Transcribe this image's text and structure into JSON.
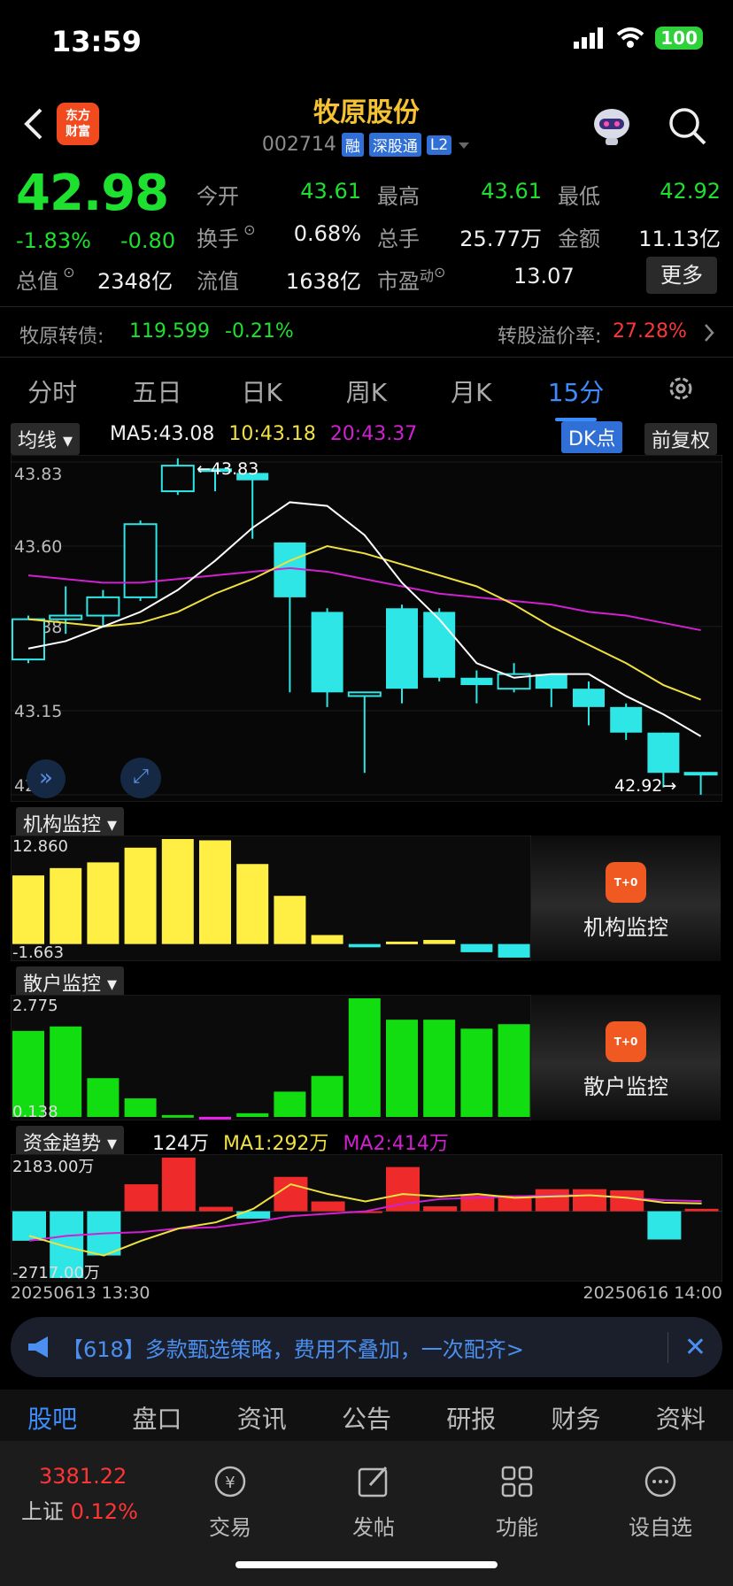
{
  "status": {
    "time": "13:59",
    "battery": "100"
  },
  "header": {
    "logo_text_1": "东方",
    "logo_text_2": "财富",
    "title": "牧原股份",
    "code": "002714",
    "tags": [
      "融",
      "深股通",
      "L2"
    ]
  },
  "quote": {
    "price": "42.98",
    "pct": "-1.83%",
    "change": "-0.80",
    "open_label": "今开",
    "open": "43.61",
    "high_label": "最高",
    "high": "43.61",
    "low_label": "最低",
    "low": "42.92",
    "turnover_label": "换手",
    "turnover": "0.68%",
    "volume_label": "总手",
    "volume": "25.77万",
    "amount_label": "金额",
    "amount": "11.13亿",
    "mktcap_label": "总值",
    "mktcap": "2348亿",
    "float_label": "流值",
    "float": "1638亿",
    "pe_label": "市盈",
    "pe_sup": "动",
    "pe": "13.07",
    "more": "更多"
  },
  "bond": {
    "label": "牧原转债:",
    "price": "119.599",
    "pct": "-0.21%",
    "premium_label": "转股溢价率:",
    "premium": "27.28%"
  },
  "tabs": [
    "分时",
    "五日",
    "日K",
    "周K",
    "月K",
    "15分"
  ],
  "chart_header": {
    "indicator": "均线",
    "ma5": "MA5:43.08",
    "ma10": "10:43.18",
    "ma20": "20:43.37",
    "dk": "DK点",
    "adjust": "前复权"
  },
  "colors": {
    "up": "#ff3535",
    "down": "#2ee6e6",
    "ma5": "#ffffff",
    "ma10": "#f0e040",
    "ma20": "#d020d0",
    "inst": "#ffee44",
    "retail": "#11dd11"
  },
  "chart_data": [
    {
      "type": "candlestick",
      "y_ticks": [
        "43.83",
        "43.60",
        "43.38",
        "43.15",
        "42.92"
      ],
      "ylim": [
        42.92,
        43.83
      ],
      "annotations": [
        "←43.83",
        "42.92→"
      ],
      "candles": [
        {
          "o": 43.29,
          "c": 43.4,
          "h": 43.41,
          "l": 43.28
        },
        {
          "o": 43.4,
          "c": 43.41,
          "h": 43.49,
          "l": 43.36
        },
        {
          "o": 43.41,
          "c": 43.46,
          "h": 43.48,
          "l": 43.38
        },
        {
          "o": 43.46,
          "c": 43.66,
          "h": 43.67,
          "l": 43.45
        },
        {
          "o": 43.75,
          "c": 43.82,
          "h": 43.84,
          "l": 43.74
        },
        {
          "o": 43.81,
          "c": 43.81,
          "h": 43.81,
          "l": 43.75
        },
        {
          "o": 43.8,
          "c": 43.78,
          "h": 43.8,
          "l": 43.62
        },
        {
          "o": 43.61,
          "c": 43.46,
          "h": 43.61,
          "l": 43.2
        },
        {
          "o": 43.42,
          "c": 43.2,
          "h": 43.43,
          "l": 43.16
        },
        {
          "o": 43.19,
          "c": 43.2,
          "h": 43.19,
          "l": 42.98
        },
        {
          "o": 43.43,
          "c": 43.21,
          "h": 43.44,
          "l": 43.17
        },
        {
          "o": 43.42,
          "c": 43.24,
          "h": 43.43,
          "l": 43.23
        },
        {
          "o": 43.24,
          "c": 43.22,
          "h": 43.26,
          "l": 43.17
        },
        {
          "o": 43.21,
          "c": 43.25,
          "h": 43.28,
          "l": 43.2
        },
        {
          "o": 43.25,
          "c": 43.21,
          "h": 43.25,
          "l": 43.16
        },
        {
          "o": 43.21,
          "c": 43.16,
          "h": 43.23,
          "l": 43.11
        },
        {
          "o": 43.16,
          "c": 43.09,
          "h": 43.17,
          "l": 43.07
        },
        {
          "o": 43.09,
          "c": 42.98,
          "h": 43.09,
          "l": 42.94
        },
        {
          "o": 42.98,
          "c": 42.98,
          "h": 42.98,
          "l": 42.92
        }
      ],
      "ma5": [
        43.32,
        43.34,
        43.38,
        43.42,
        43.48,
        43.56,
        43.65,
        43.72,
        43.71,
        43.63,
        43.5,
        43.4,
        43.28,
        43.24,
        43.25,
        43.25,
        43.19,
        43.14,
        43.08
      ],
      "ma10": [
        43.4,
        43.39,
        43.38,
        43.39,
        43.42,
        43.47,
        43.51,
        43.56,
        43.6,
        43.58,
        43.55,
        43.52,
        43.49,
        43.44,
        43.38,
        43.33,
        43.28,
        43.22,
        43.18
      ],
      "ma20": [
        43.52,
        43.51,
        43.5,
        43.5,
        43.51,
        43.52,
        43.53,
        43.54,
        43.53,
        43.51,
        43.49,
        43.47,
        43.46,
        43.45,
        43.44,
        43.42,
        43.41,
        43.39,
        43.37
      ]
    },
    {
      "type": "bar",
      "title": "机构监控",
      "y_ticks": [
        "12.860",
        "-1.663"
      ],
      "ylim": [
        -1.663,
        12.86
      ],
      "values": [
        8.4,
        9.3,
        10.0,
        11.8,
        12.86,
        12.7,
        9.8,
        5.9,
        1.1,
        -0.4,
        0.3,
        0.5,
        -1.0,
        -1.66
      ]
    },
    {
      "type": "bar",
      "title": "散户监控",
      "y_ticks": [
        "2.775",
        "0.138"
      ],
      "ylim": [
        0.138,
        2.775
      ],
      "values": [
        2.05,
        2.15,
        1.0,
        0.55,
        0.18,
        0.14,
        0.22,
        0.7,
        1.05,
        2.775,
        2.3,
        2.3,
        2.1,
        2.2
      ]
    },
    {
      "type": "bar",
      "title": "资金趋势",
      "y_ticks": [
        "2183.00万",
        "-2717.00万"
      ],
      "ylim": [
        -2717,
        2183
      ],
      "x_start": "20250613 13:30",
      "x_end": "20250616 14:00",
      "legend": [
        "124万",
        "MA1:292万",
        "MA2:414万"
      ],
      "values": [
        -1200,
        -2717,
        -1800,
        1100,
        2183,
        180,
        -300,
        1400,
        400,
        0,
        1800,
        200,
        650,
        650,
        900,
        900,
        850,
        -1150,
        100
      ],
      "ma1": [
        -1000,
        -1450,
        -1800,
        -1200,
        -700,
        -450,
        100,
        1100,
        700,
        400,
        700,
        600,
        700,
        550,
        600,
        650,
        550,
        350,
        320
      ],
      "ma2": [
        -1200,
        -1000,
        -900,
        -850,
        -700,
        -650,
        -450,
        -200,
        -100,
        0,
        300,
        500,
        550,
        600,
        650,
        650,
        550,
        450,
        414
      ]
    }
  ],
  "inst_panel": {
    "title": "机构监控",
    "card_label": "机构监控"
  },
  "retail_panel": {
    "title": "散户监控",
    "card_label": "散户监控"
  },
  "fund_panel": {
    "title": "资金趋势",
    "val": "124万",
    "ma1": "MA1:292万",
    "ma2": "MA2:414万"
  },
  "banner": {
    "text": "【618】多款甄选策略，费用不叠加，一次配齐>"
  },
  "news_tabs": [
    "股吧",
    "盘口",
    "资讯",
    "公告",
    "研报",
    "财务",
    "资料"
  ],
  "bottom": {
    "index_value": "3381.22",
    "index_name": "上证",
    "index_pct": "0.12%",
    "items": [
      "交易",
      "发帖",
      "功能",
      "设自选"
    ]
  }
}
